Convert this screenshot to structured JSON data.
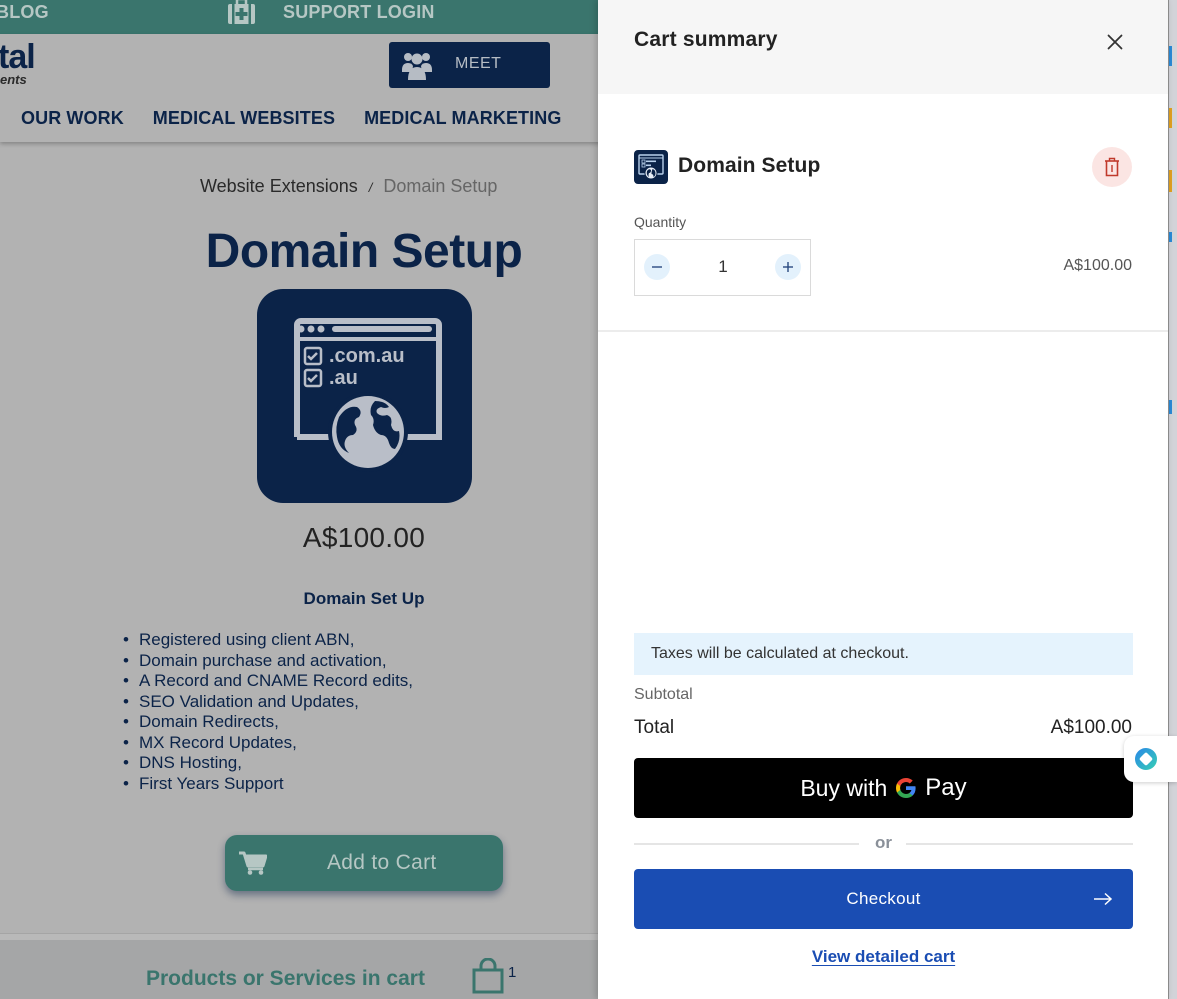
{
  "background_page": {
    "topbar": {
      "blog_label": "BLOG",
      "support_label": "SUPPORT LOGIN",
      "support_icon": "medical-kit-icon"
    },
    "header": {
      "logo_text": "tal",
      "logo_tagline": "ents",
      "meet_button_label": "MEET",
      "meet_icon": "people-group-icon"
    },
    "nav": [
      {
        "label": "OUR WORK"
      },
      {
        "label": "MEDICAL WEBSITES"
      },
      {
        "label": "MEDICAL MARKETING"
      }
    ],
    "breadcrumb": {
      "parent": "Website Extensions",
      "separator": "/",
      "current": "Domain Setup"
    },
    "product": {
      "title": "Domain Setup",
      "image_text_line1": ".com.au",
      "image_text_line2": ".au",
      "price": "A$100.00",
      "description_heading": "Domain Set Up",
      "features": [
        "Registered using client ABN,",
        "Domain purchase and activation,",
        "A Record and CNAME Record edits,",
        "SEO Validation and Updates,",
        "Domain Redirects,",
        "MX Record Updates,",
        "DNS Hosting,",
        "First Years Support"
      ],
      "add_to_cart_label": "Add to Cart"
    },
    "footer": {
      "cart_text": "Products or Services in cart",
      "cart_count": "1"
    }
  },
  "cart_drawer": {
    "title": "Cart summary",
    "close_icon": "close-icon",
    "items": [
      {
        "name": "Domain Setup",
        "quantity_label": "Quantity",
        "quantity": "1",
        "price": "A$100.00"
      }
    ],
    "tax_note": "Taxes will be calculated at checkout.",
    "subtotal_label": "Subtotal",
    "total_label": "Total",
    "total_value": "A$100.00",
    "gpay": {
      "buy_with": "Buy with",
      "pay": "Pay"
    },
    "or_label": "or",
    "checkout_label": "Checkout",
    "view_cart_label": "View detailed cart"
  },
  "colors": {
    "brand_navy": "#0b2348",
    "brand_teal": "#3a756d",
    "checkout_blue": "#1a4db3",
    "remove_bg": "#fbe5e3",
    "remove_icon": "#c0392b",
    "tax_note_bg": "#e5f3fd"
  }
}
